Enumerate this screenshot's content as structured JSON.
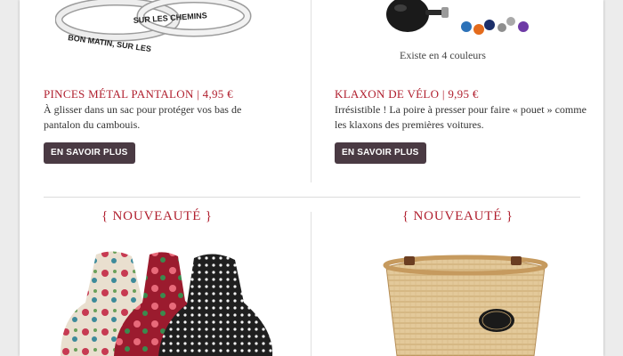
{
  "products": [
    {
      "title": "PINCES MÉTAL PANTALON | 4,95 €",
      "description": "À glisser dans un sac pour protéger vos bas de pantalon du cambouis.",
      "button": "EN SAVOIR PLUS",
      "band_text_1": "BON MATIN, SUR LES",
      "band_text_2": "SUR LES CHEMINS"
    },
    {
      "title": "KLAXON DE VÉLO | 9,95 €",
      "description": "Irrésistible ! La poire à presser pour faire « pouet » comme les klaxons des premières voitures.",
      "button": "EN SAVOIR PLUS",
      "note": "Existe en 4 couleurs"
    }
  ],
  "new_items": [
    {
      "label": "{ NOUVEAUTÉ }"
    },
    {
      "label": "{ NOUVEAUTÉ }"
    }
  ],
  "colors": {
    "accent": "#b01f2e",
    "button": "#4a3a43"
  }
}
